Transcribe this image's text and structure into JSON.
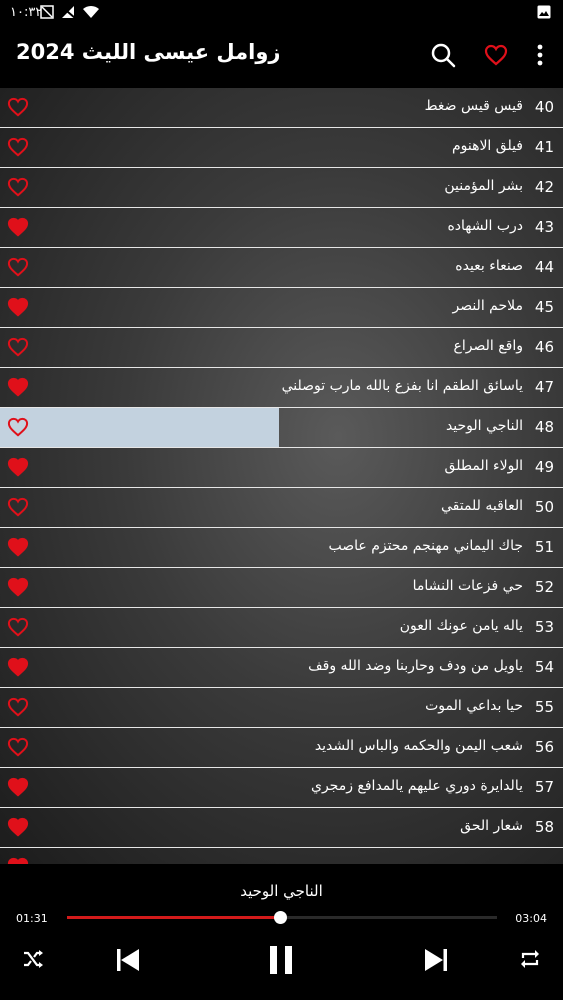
{
  "status": {
    "time": "١٠:٣٢"
  },
  "appbar": {
    "title": "زوامل عيسى الليث 2024"
  },
  "tracks": [
    {
      "num": "40",
      "name": "قيس قيس ضغط",
      "fav": false
    },
    {
      "num": "41",
      "name": "فيلق الاهنوم",
      "fav": false
    },
    {
      "num": "42",
      "name": "بشر المؤمنين",
      "fav": false
    },
    {
      "num": "43",
      "name": "درب الشهاده",
      "fav": true
    },
    {
      "num": "44",
      "name": "صنعاء بعيده",
      "fav": false
    },
    {
      "num": "45",
      "name": "ملاحم النصر",
      "fav": true
    },
    {
      "num": "46",
      "name": "واقع الصراع",
      "fav": false
    },
    {
      "num": "47",
      "name": "ياسائق الطقم انا بفزع بالله مارب توصلني",
      "fav": true
    },
    {
      "num": "48",
      "name": "الناجي الوحيد",
      "fav": false,
      "active": true
    },
    {
      "num": "49",
      "name": "الولاء المطلق",
      "fav": true
    },
    {
      "num": "50",
      "name": "العاقبه للمتقي",
      "fav": false
    },
    {
      "num": "51",
      "name": "جاك اليماني مهنجم محتزم عاصب",
      "fav": true
    },
    {
      "num": "52",
      "name": "حي فزعات النشاما",
      "fav": true
    },
    {
      "num": "53",
      "name": "ياله يامن عونك العون",
      "fav": false
    },
    {
      "num": "54",
      "name": "ياويل من ودف وحاربنا وضد الله وقف",
      "fav": true
    },
    {
      "num": "55",
      "name": "حيا بداعي الموت",
      "fav": false
    },
    {
      "num": "56",
      "name": "شعب اليمن والحكمه والباس الشديد",
      "fav": false
    },
    {
      "num": "57",
      "name": "يالدايرة دوري عليهم يالمدافع زمجري",
      "fav": true
    },
    {
      "num": "58",
      "name": "شعار الحق",
      "fav": true
    }
  ],
  "player": {
    "now_playing": "الناجي الوحيد",
    "elapsed": "01:31",
    "total": "03:04",
    "progress": 0.495
  },
  "colors": {
    "accent": "#d21a1a",
    "highlight": "#c3d2df"
  }
}
